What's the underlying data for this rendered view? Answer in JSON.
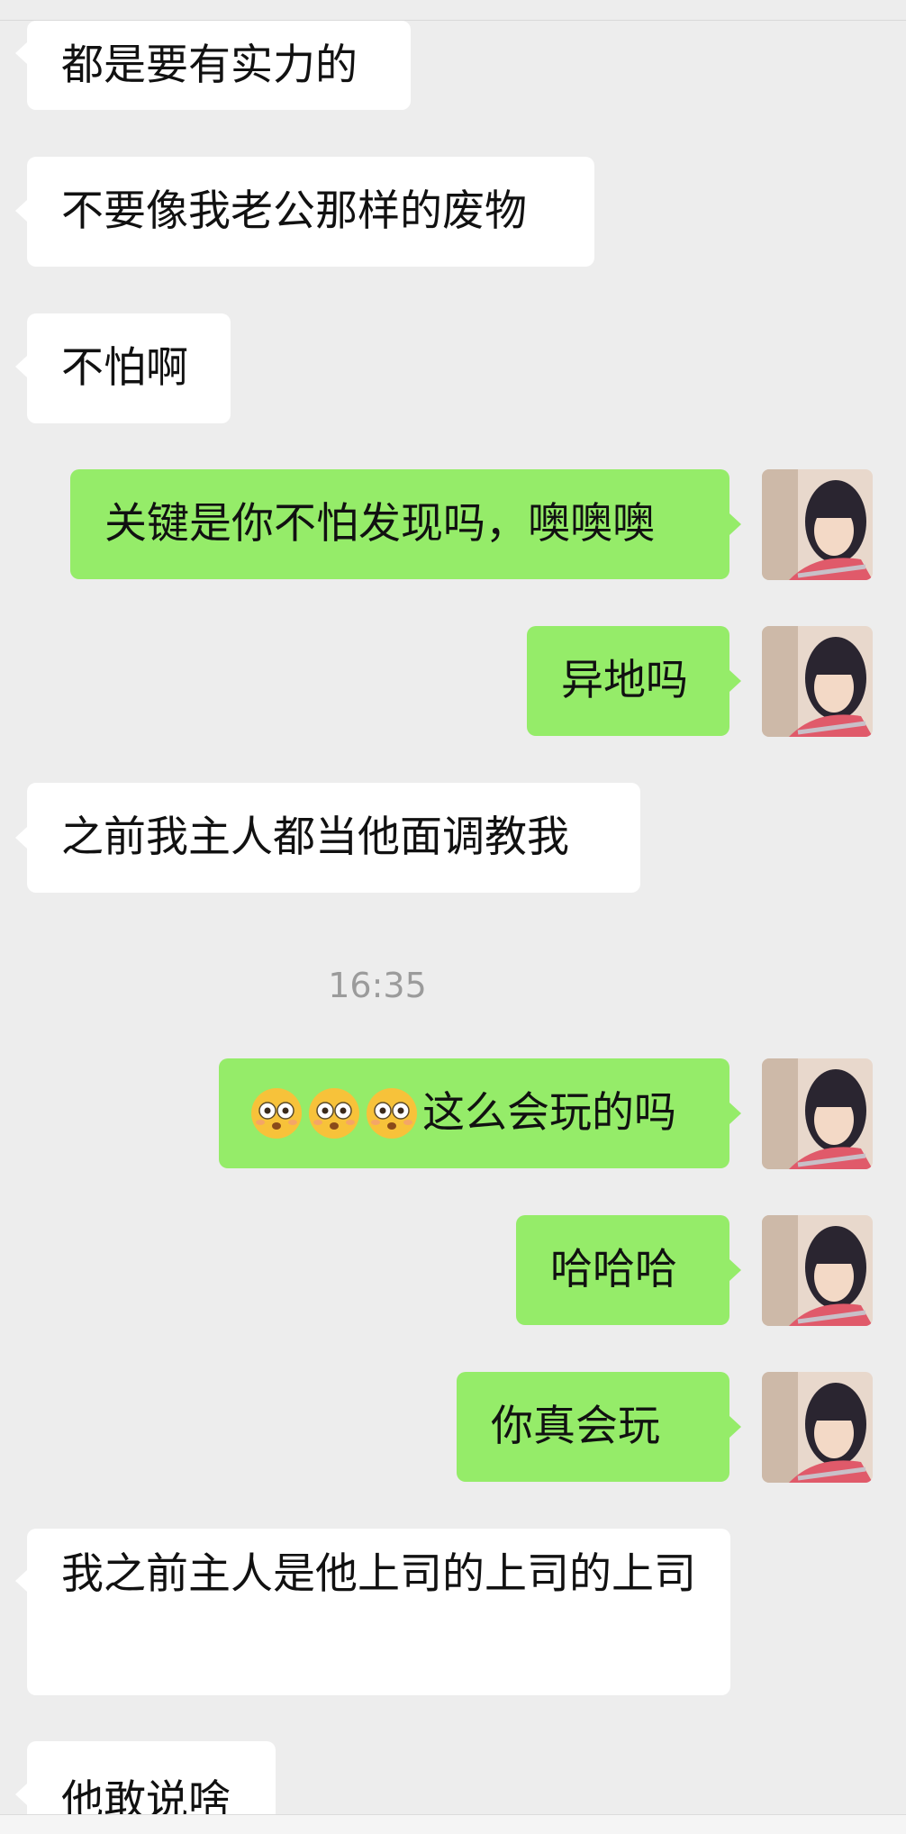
{
  "chat": {
    "timestamp": "16:35",
    "messages": [
      {
        "side": "in",
        "text": "都是要有实力的"
      },
      {
        "side": "in",
        "text": "不要像我老公那样的废物"
      },
      {
        "side": "in",
        "text": "不怕啊"
      },
      {
        "side": "out",
        "text": "关键是你不怕发现吗，噢噢噢"
      },
      {
        "side": "out",
        "text": "异地吗"
      },
      {
        "side": "in",
        "text": "之前我主人都当他面调教我"
      },
      {
        "side": "out",
        "emoji_count": 3,
        "emoji_icon": "flushed-face-icon",
        "text": "这么会玩的吗"
      },
      {
        "side": "out",
        "text": "哈哈哈"
      },
      {
        "side": "out",
        "text": "你真会玩"
      },
      {
        "side": "in",
        "text": "我之前主人是他上司的上司的上司"
      },
      {
        "side": "in",
        "text": "他敢说啥"
      }
    ]
  },
  "colors": {
    "background": "#ededed",
    "incoming_bubble": "#ffffff",
    "outgoing_bubble": "#95ec69",
    "timestamp_text": "#9b9b9b"
  },
  "avatar": {
    "icon": "user-avatar-photo"
  }
}
